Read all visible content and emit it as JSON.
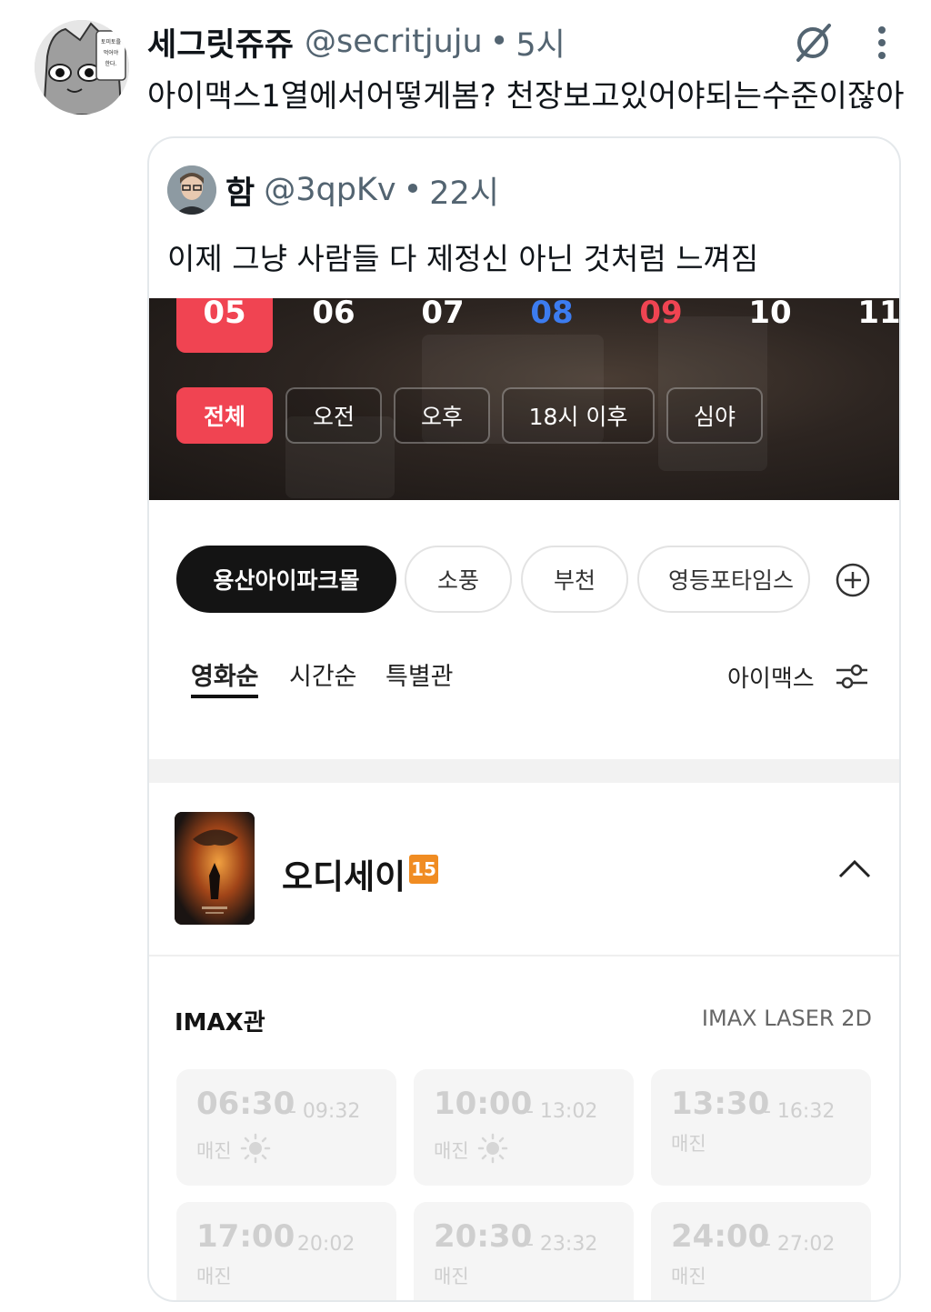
{
  "tweet": {
    "display_name": "세그릿쥬쥬",
    "handle": "@secritjuju",
    "separator": "•",
    "time": "5시",
    "text": "아이맥스1열에서어떻게봄? 천장보고있어야되는수준이잖아",
    "avatar_speech": [
      "토미토를",
      "먹어야",
      "한다."
    ],
    "icons": [
      "grok-icon",
      "more-icon"
    ]
  },
  "quote": {
    "display_name": "함",
    "handle": "@3qpKv",
    "separator": "•",
    "time": "22시",
    "text": "이제 그냥 사람들 다 제정신 아닌 것처럼 느껴짐"
  },
  "app": {
    "dates": [
      {
        "label": "05",
        "state": "selected"
      },
      {
        "label": "06",
        "state": "normal"
      },
      {
        "label": "07",
        "state": "normal"
      },
      {
        "label": "08",
        "state": "saturday"
      },
      {
        "label": "09",
        "state": "sunday"
      },
      {
        "label": "10",
        "state": "normal"
      },
      {
        "label": "11",
        "state": "normal"
      }
    ],
    "time_filters": [
      {
        "label": "전체",
        "active": true
      },
      {
        "label": "오전",
        "active": false
      },
      {
        "label": "오후",
        "active": false
      },
      {
        "label": "18시 이후",
        "active": false
      },
      {
        "label": "심야",
        "active": false
      }
    ],
    "theaters": [
      {
        "label": "용산아이파크몰",
        "active": true
      },
      {
        "label": "소풍",
        "active": false
      },
      {
        "label": "부천",
        "active": false
      },
      {
        "label": "영등포타임스",
        "active": false
      }
    ],
    "sort_tabs": [
      {
        "label": "영화순",
        "active": true
      },
      {
        "label": "시간순",
        "active": false
      },
      {
        "label": "특별관",
        "active": false
      }
    ],
    "filter_label": "아이맥스",
    "movie": {
      "title": "오디세이",
      "rating": "15",
      "hall": "IMAX관",
      "format": "IMAX LASER 2D",
      "showtimes": [
        {
          "start": "06:30",
          "end": "- 09:32",
          "status": "매진",
          "morning": true
        },
        {
          "start": "10:00",
          "end": "- 13:02",
          "status": "매진",
          "morning": true
        },
        {
          "start": "13:30",
          "end": "- 16:32",
          "status": "매진",
          "morning": false
        },
        {
          "start": "17:00",
          "end": "- 20:02",
          "status": "매진",
          "morning": false
        },
        {
          "start": "20:30",
          "end": "- 23:32",
          "status": "매진",
          "morning": false
        },
        {
          "start": "24:00",
          "end": "- 27:02",
          "status": "매진",
          "morning": false
        }
      ]
    },
    "colors": {
      "accent_red": "#f04452",
      "saturday_blue": "#3c7cf0",
      "rating_orange": "#f08c22",
      "active_chip_black": "#141414"
    }
  }
}
